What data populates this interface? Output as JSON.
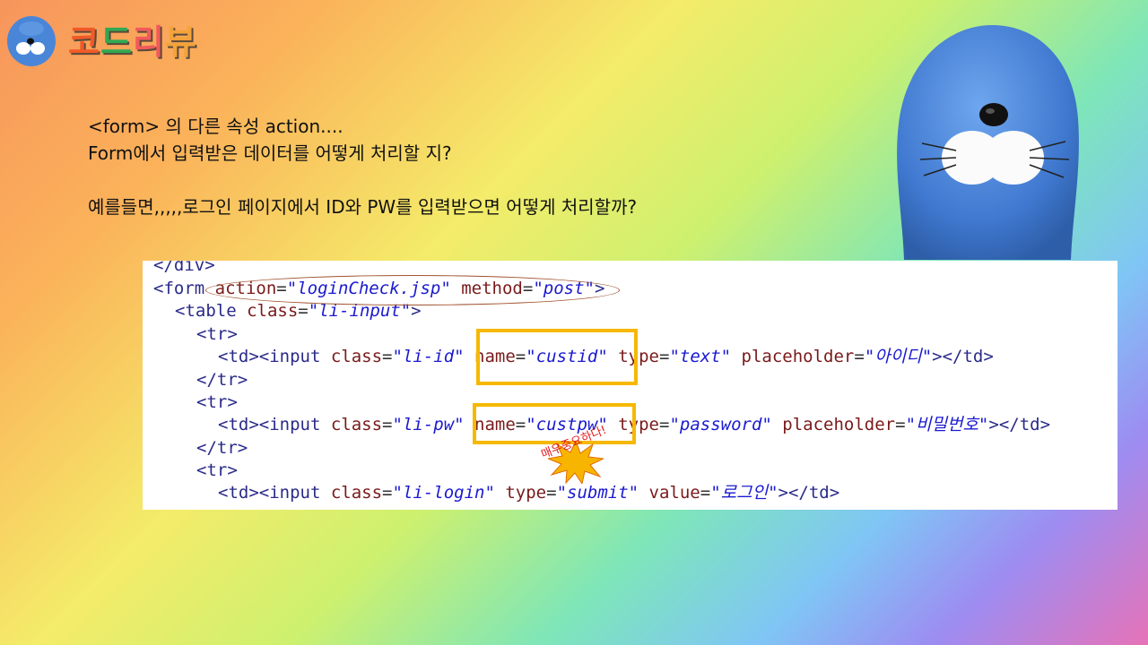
{
  "logo": {
    "chars": [
      "코",
      "드",
      "리",
      "뷰"
    ]
  },
  "body": {
    "line1": "<form> 의 다른 속성 action....",
    "line2": "Form에서 입력받은 데이터를 어떻게 처리할 지?",
    "line3": "예를들면,,,,,로그인 페이지에서 ID와 PW를 입력받으면 어떻게 처리할까?"
  },
  "code": {
    "l0": "</div>",
    "l1": {
      "open": "<form",
      "a1": "action",
      "v1": "\"loginCheck.jsp\"",
      "a2": "method",
      "v2": "\"post\"",
      "close": ">"
    },
    "l2": {
      "open": "<table",
      "a1": "class",
      "v1": "\"li-input\"",
      "close": ">"
    },
    "l3": "<tr>",
    "l4": {
      "open": "<td><input",
      "a1": "class",
      "v1": "\"li-id\"",
      "a2": "name",
      "v2": "\"custid\"",
      "a3": "type",
      "v3": "\"text\"",
      "a4": "placeholder",
      "v4": "\"아이디\"",
      "close": "></td>"
    },
    "l5": "</tr>",
    "l6": "<tr>",
    "l7": {
      "open": "<td><input",
      "a1": "class",
      "v1": "\"li-pw\"",
      "a2": "name",
      "v2": "\"custpw\"",
      "a3": "type",
      "v3": "\"password\"",
      "a4": "placeholder",
      "v4": "\"비밀번호\"",
      "close": "></td>"
    },
    "l8": "</tr>",
    "l9": "<tr>",
    "l10": {
      "open": "<td><input",
      "a1": "class",
      "v1": "\"li-login\"",
      "a2": "type",
      "v2": "\"submit\"",
      "a3": "value",
      "v3": "\"로그인\"",
      "close": "></td>"
    }
  },
  "annotation": {
    "burst_label": "매우중요하다!"
  },
  "colors": {
    "highlight_box": "#f6b800",
    "oval": "#a0522d",
    "mascot_blue": "#4a86d8"
  }
}
